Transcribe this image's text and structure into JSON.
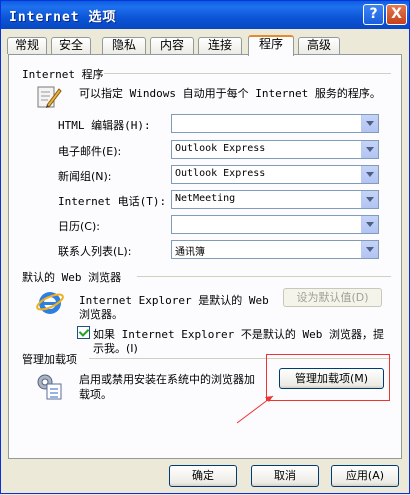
{
  "window": {
    "title": "Internet 选项",
    "help_label": "?",
    "close_label": "X"
  },
  "tabs": [
    {
      "label": "常规"
    },
    {
      "label": "安全"
    },
    {
      "label": "隐私"
    },
    {
      "label": "内容"
    },
    {
      "label": "连接"
    },
    {
      "label": "程序",
      "active": true
    },
    {
      "label": "高级"
    }
  ],
  "programs": {
    "group_title": "Internet 程序",
    "description": "可以指定 Windows 自动用于每个 Internet 服务的程序。",
    "rows": [
      {
        "label": "HTML 编辑器(H):",
        "value": ""
      },
      {
        "label": "电子邮件(E):",
        "value": "Outlook Express"
      },
      {
        "label": "新闻组(N):",
        "value": "Outlook Express"
      },
      {
        "label": "Internet 电话(T):",
        "value": "NetMeeting"
      },
      {
        "label": "日历(C):",
        "value": ""
      },
      {
        "label": "联系人列表(L):",
        "value": "通讯簿"
      }
    ]
  },
  "default_browser": {
    "group_title": "默认的 Web 浏览器",
    "text_line1": "Internet Explorer 是默认的 Web",
    "text_line2": "浏览器。",
    "set_default_button": "设为默认值(D)",
    "checkbox_line1": "如果 Internet Explorer 不是默认的 Web 浏览器，提",
    "checkbox_line2": "示我。(I)",
    "checkbox_checked": true
  },
  "addons": {
    "group_title": "管理加载项",
    "text_line1": "启用或禁用安装在系统中的浏览器加",
    "text_line2": "载项。",
    "manage_button": "管理加载项(M)"
  },
  "footer": {
    "ok_button": "确定",
    "cancel_button": "取消",
    "apply_button": "应用(A)"
  },
  "colors": {
    "titlebar": "#0a5fe0",
    "annotation": "#e33333",
    "tab_highlight": "#e68b2c"
  }
}
